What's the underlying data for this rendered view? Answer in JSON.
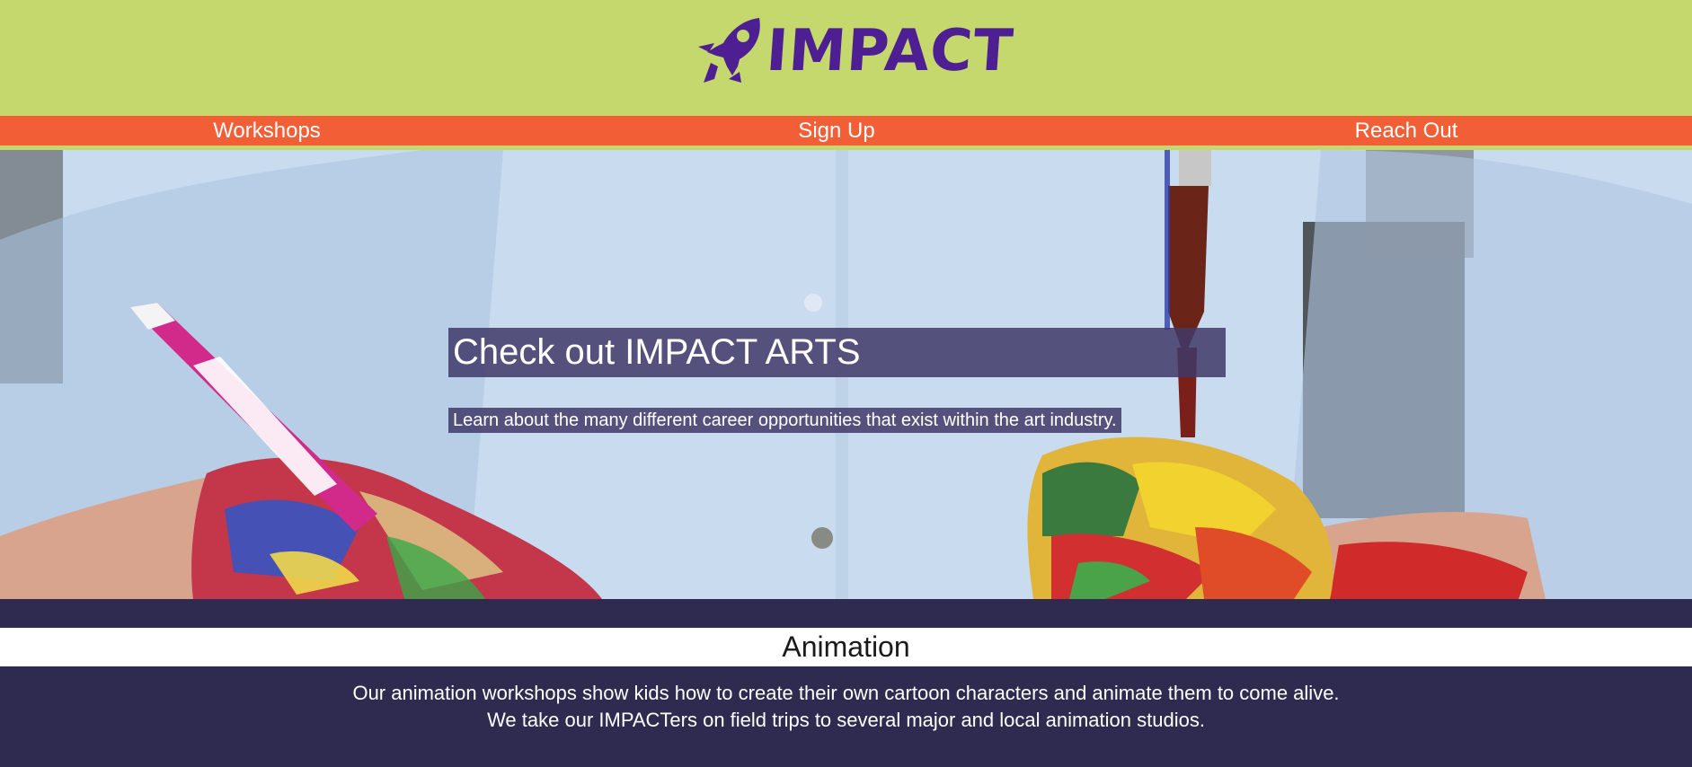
{
  "brand": {
    "name": "IMPACT",
    "logo_icon": "rocket-icon",
    "colors": {
      "header_bg": "#c5d86d",
      "nav_bg": "#f25f36",
      "logo": "#4e1f92",
      "dark": "#2e2a50"
    }
  },
  "nav": {
    "items": [
      {
        "label": "Workshops"
      },
      {
        "label": "Sign Up"
      },
      {
        "label": "Reach Out"
      }
    ]
  },
  "hero": {
    "title": "Check out IMPACT ARTS",
    "subtitle": "Learn about the many different career opportunities that exist within the art industry."
  },
  "section": {
    "title": "Animation",
    "lines": [
      "Our animation workshops show kids how to create their own cartoon characters and animate them to come alive.",
      "We take our IMPACTers on field trips to several major and local animation studios."
    ]
  }
}
